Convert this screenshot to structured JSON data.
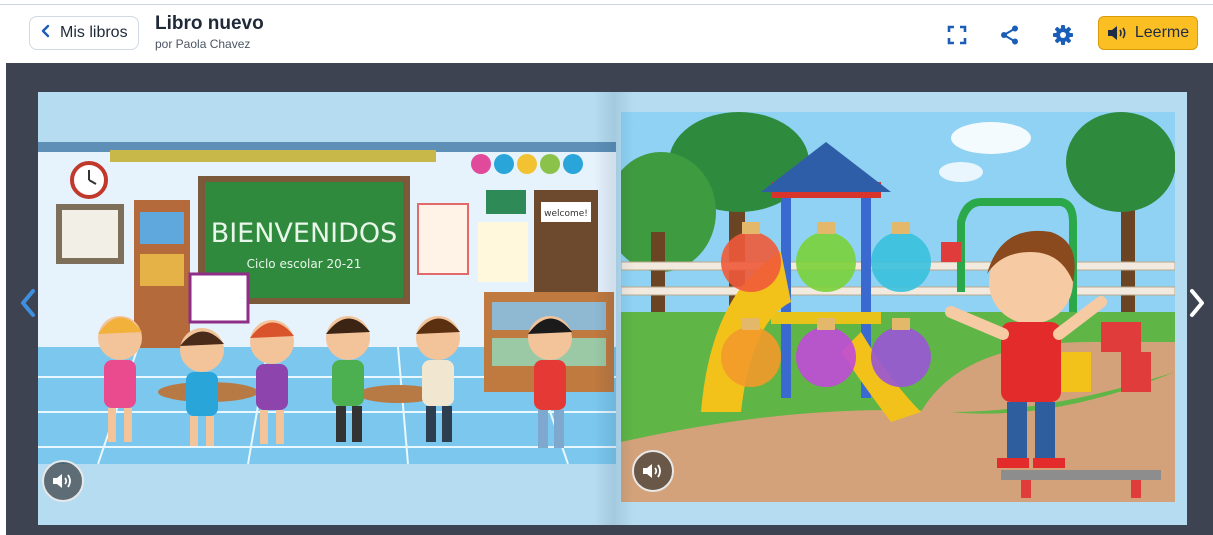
{
  "header": {
    "back_label": "Mis libros",
    "title": "Libro nuevo",
    "subtitle": "por Paola Chavez",
    "read_label": "Leerme",
    "icons": [
      "chevron-left-icon",
      "fullscreen-icon",
      "share-icon",
      "gear-icon",
      "speaker-icon"
    ],
    "accent_color": "#1b5eb8",
    "read_button_color": "#fbbf24"
  },
  "book": {
    "left_page": {
      "scene": "classroom",
      "board_title": "BIENVENIDOS",
      "board_subtitle": "Ciclo escolar 20-21",
      "door_sign": "welcome!"
    },
    "right_page": {
      "scene": "playground"
    },
    "controls": [
      "prev-page-arrow",
      "next-page-arrow",
      "left-page-audio",
      "right-page-audio"
    ]
  },
  "colors": {
    "stage_bg": "#3d4350",
    "page_bg": "#b6dcf1"
  }
}
